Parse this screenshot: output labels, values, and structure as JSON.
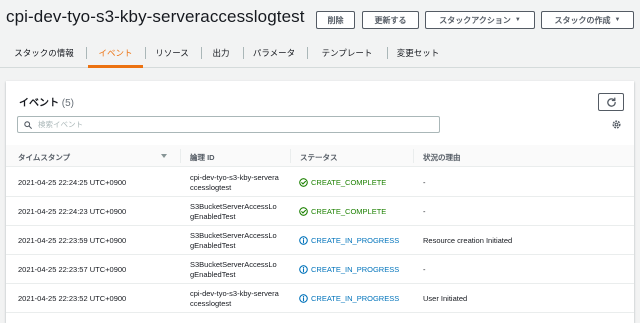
{
  "header": {
    "stack_name": "cpi-dev-tyo-s3-kby-serveraccesslogtest",
    "buttons": {
      "delete": "削除",
      "update": "更新する",
      "stack_actions": "スタックアクション",
      "create_stack": "スタックの作成"
    }
  },
  "tabs": [
    "スタックの情報",
    "イベント",
    "リソース",
    "出力",
    "パラメータ",
    "テンプレート",
    "変更セット"
  ],
  "active_tab": "イベント",
  "events": {
    "title": "イベント",
    "count": "(5)",
    "search_placeholder": "検索イベント",
    "columns": {
      "timestamp": "タイムスタンプ",
      "logical_id": "論理 ID",
      "status": "ステータス",
      "reason": "状況の理由"
    },
    "rows": [
      {
        "timestamp": "2021-04-25 22:24:25 UTC+0900",
        "logical_id": "cpi-dev-tyo-s3-kby-serveraccesslogtest",
        "status": "CREATE_COMPLETE",
        "status_type": "complete",
        "reason": "-"
      },
      {
        "timestamp": "2021-04-25 22:24:23 UTC+0900",
        "logical_id": "S3BucketServerAccessLogEnabledTest",
        "status": "CREATE_COMPLETE",
        "status_type": "complete",
        "reason": "-"
      },
      {
        "timestamp": "2021-04-25 22:23:59 UTC+0900",
        "logical_id": "S3BucketServerAccessLogEnabledTest",
        "status": "CREATE_IN_PROGRESS",
        "status_type": "progress",
        "reason": "Resource creation Initiated"
      },
      {
        "timestamp": "2021-04-25 22:23:57 UTC+0900",
        "logical_id": "S3BucketServerAccessLogEnabledTest",
        "status": "CREATE_IN_PROGRESS",
        "status_type": "progress",
        "reason": "-"
      },
      {
        "timestamp": "2021-04-25 22:23:52 UTC+0900",
        "logical_id": "cpi-dev-tyo-s3-kby-serveraccesslogtest",
        "status": "CREATE_IN_PROGRESS",
        "status_type": "progress",
        "reason": "User Initiated"
      }
    ]
  },
  "colors": {
    "accent": "#ec7211",
    "success": "#1d8102",
    "info": "#0073bb"
  }
}
